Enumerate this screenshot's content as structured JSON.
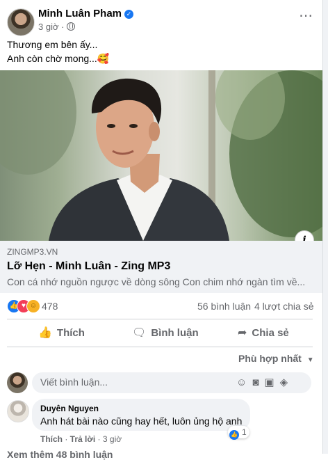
{
  "post": {
    "author": "Minh Luân Pham",
    "time": "3 giờ",
    "caption_line1": "Thương em bên ấy...",
    "caption_line2": "Anh còn chờ mong...🥰",
    "more_icon": "⋯"
  },
  "link": {
    "domain": "ZINGMP3.VN",
    "title": "Lỡ Hẹn - Minh Luân - Zing MP3",
    "description": "Con cá nhớ nguồn ngược về dòng sông Con chim nhớ ngàn tìm về..."
  },
  "stats": {
    "reaction_count": "478",
    "comments": "56 bình luận",
    "shares": "4 lượt chia sẻ"
  },
  "actions": {
    "like": "Thích",
    "comment": "Bình luận",
    "share": "Chia sẻ"
  },
  "sort_label": "Phù hợp nhất",
  "comment_box": {
    "placeholder": "Viết bình luận..."
  },
  "comment": {
    "author": "Duyên Nguyen",
    "text": "Anh hát bài nào cũng hay hết, luôn ủng hộ anh",
    "reaction_count": "1",
    "like": "Thích",
    "reply": "Trả lời",
    "time": "3 giờ"
  },
  "see_more": "Xem thêm 48 bình luận",
  "colors": {
    "accent": "#1877f2",
    "secondary_text": "#65676b",
    "surface": "#f0f2f5"
  },
  "icons": [
    "verified-icon",
    "globe-icon",
    "more-icon",
    "info-icon",
    "like-icon",
    "comment-icon",
    "share-icon",
    "chevron-down-icon",
    "emoji-icon",
    "camera-icon",
    "gif-icon",
    "sticker-icon"
  ]
}
